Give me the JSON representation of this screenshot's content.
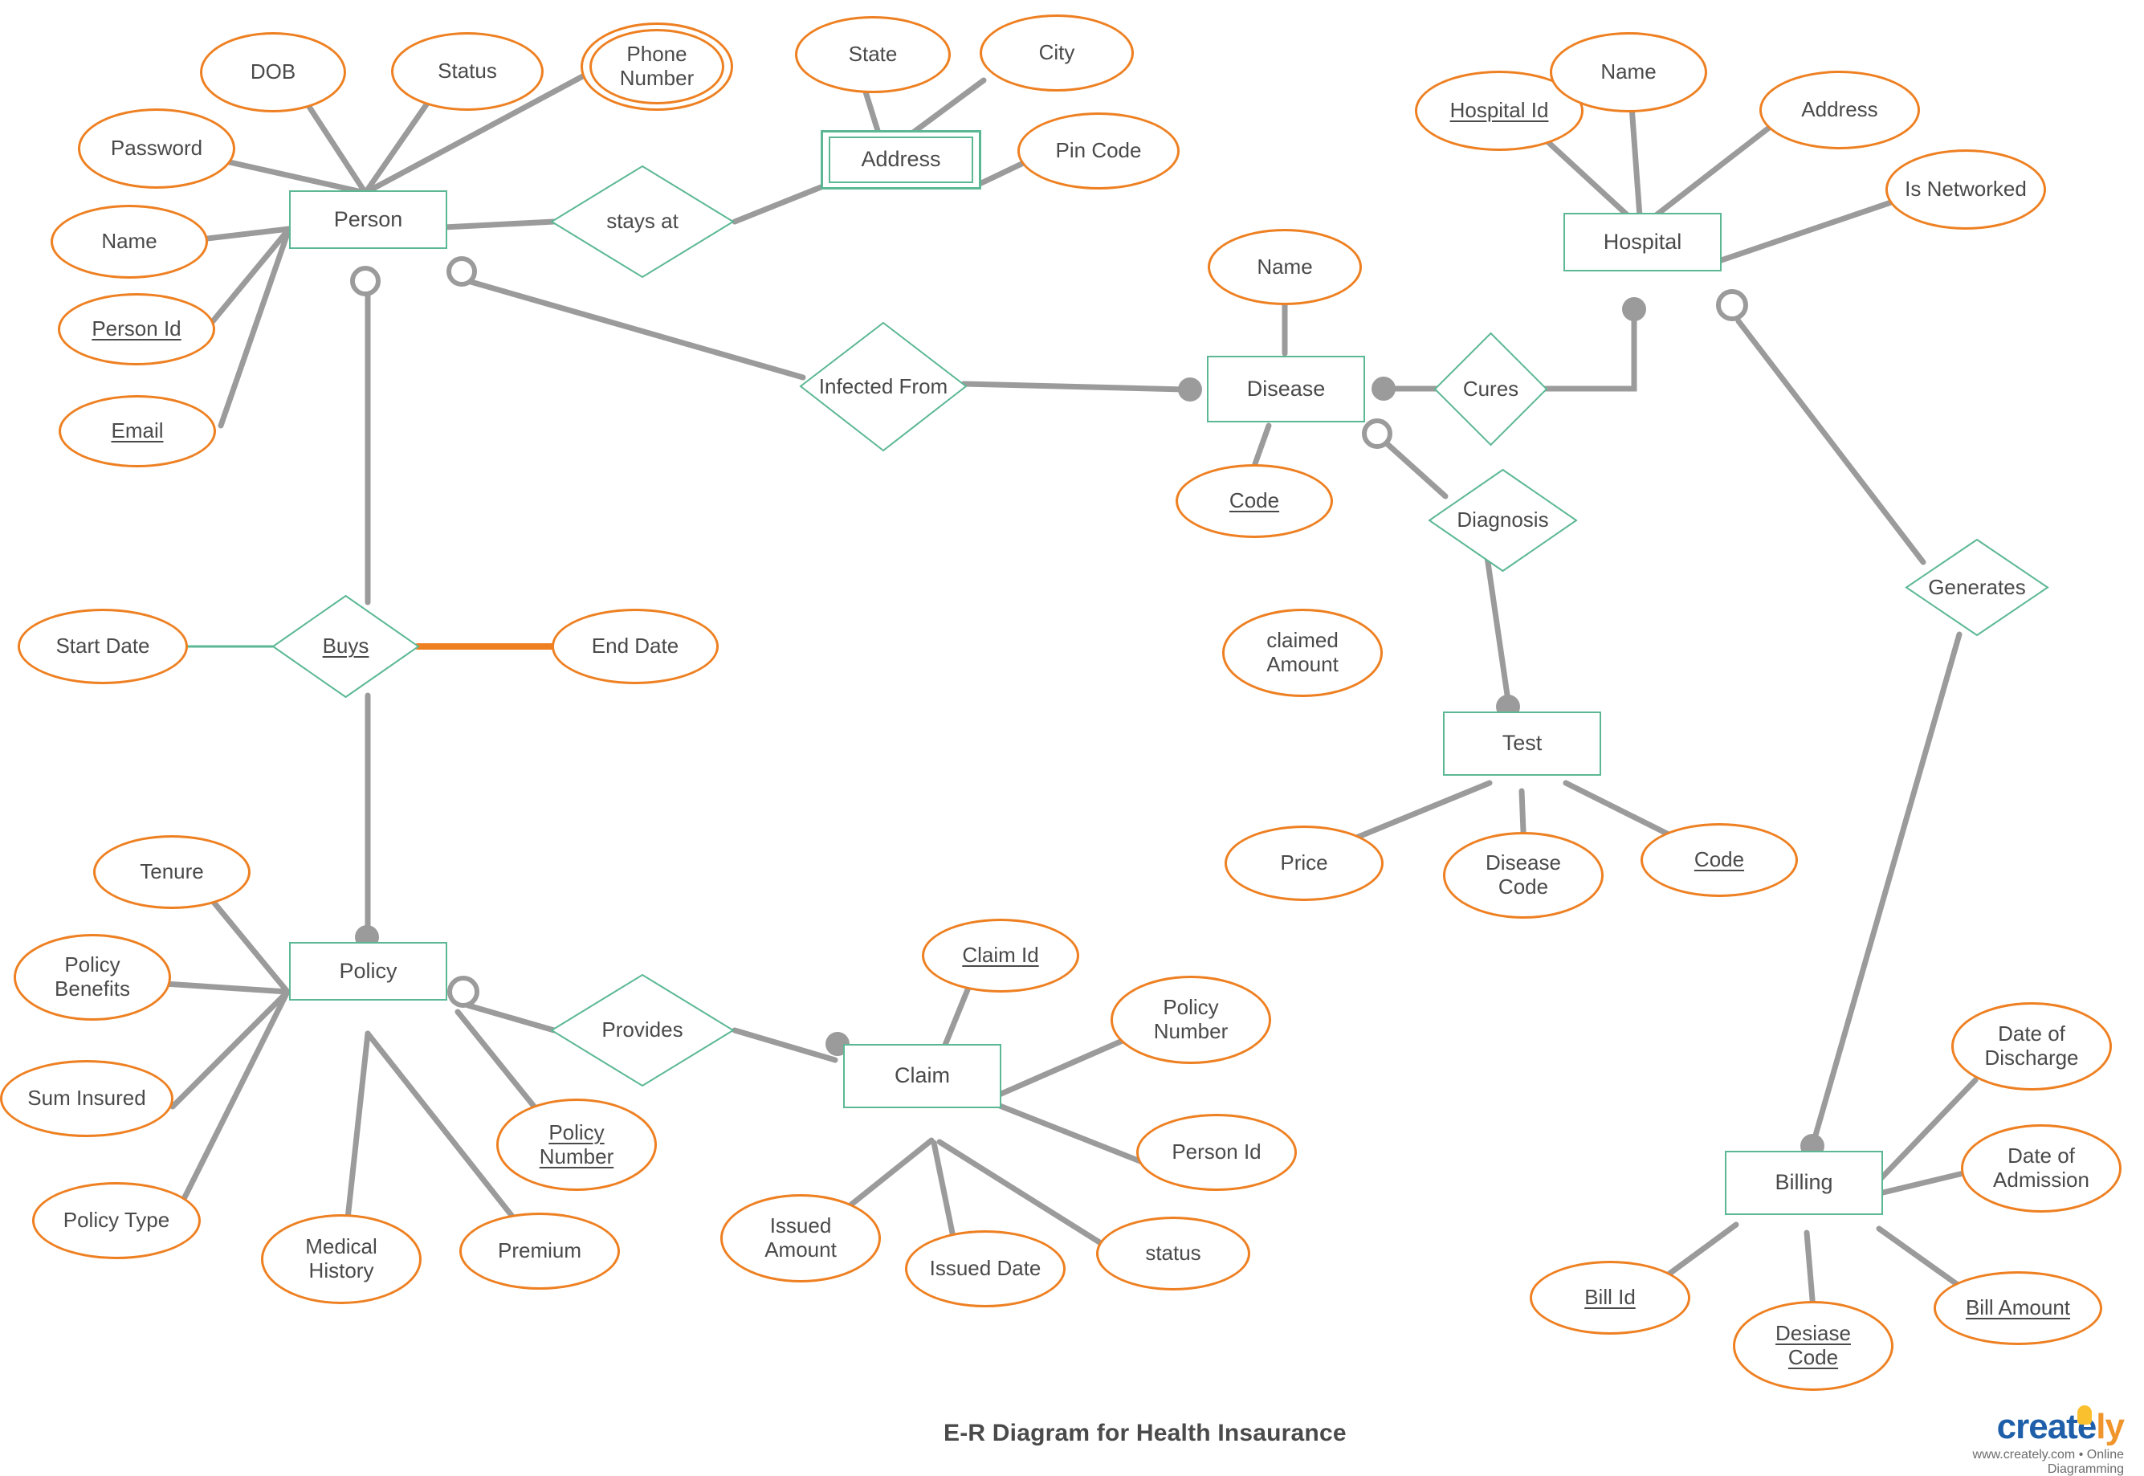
{
  "diagram": {
    "title": "E-R Diagram for Health Insaurance",
    "colors": {
      "entity_stroke": "#5cb894",
      "attribute_stroke": "#ee8022",
      "relationship_stroke": "#5cb894",
      "connector": "#9b9b9b",
      "text": "#4a4a4a",
      "start_date_link": "#5cb894",
      "end_date_link": "#ee8022"
    },
    "entities": [
      {
        "id": "person",
        "label": "Person",
        "type": "entity"
      },
      {
        "id": "address",
        "label": "Address",
        "type": "weak-entity"
      },
      {
        "id": "hospital",
        "label": "Hospital",
        "type": "entity"
      },
      {
        "id": "disease",
        "label": "Disease",
        "type": "entity"
      },
      {
        "id": "test",
        "label": "Test",
        "type": "entity"
      },
      {
        "id": "policy",
        "label": "Policy",
        "type": "entity"
      },
      {
        "id": "claim",
        "label": "Claim",
        "type": "entity"
      },
      {
        "id": "billing",
        "label": "Billing",
        "type": "entity"
      }
    ],
    "relationships": [
      {
        "id": "stays-at",
        "label": "stays at",
        "key": false
      },
      {
        "id": "infected-from",
        "label": "Infected From",
        "key": false
      },
      {
        "id": "cures",
        "label": "Cures",
        "key": false
      },
      {
        "id": "diagnosis",
        "label": "Diagnosis",
        "key": false
      },
      {
        "id": "generates",
        "label": "Generates",
        "key": false
      },
      {
        "id": "buys",
        "label": "Buys",
        "key": true
      },
      {
        "id": "provides",
        "label": "Provides",
        "key": false
      }
    ],
    "attributes": {
      "person": [
        {
          "id": "dob",
          "label": "DOB",
          "key": false,
          "multivalued": false
        },
        {
          "id": "status",
          "label": "Status",
          "key": false,
          "multivalued": false
        },
        {
          "id": "phone-number",
          "label": "Phone Number",
          "key": false,
          "multivalued": true
        },
        {
          "id": "password",
          "label": "Password",
          "key": false,
          "multivalued": false
        },
        {
          "id": "name",
          "label": "Name",
          "key": false,
          "multivalued": false
        },
        {
          "id": "person-id",
          "label": "Person Id",
          "key": true,
          "multivalued": false
        },
        {
          "id": "email",
          "label": "Email",
          "key": true,
          "multivalued": false
        }
      ],
      "address": [
        {
          "id": "state",
          "label": "State",
          "key": false,
          "multivalued": false
        },
        {
          "id": "city",
          "label": "City",
          "key": false,
          "multivalued": false
        },
        {
          "id": "pin-code",
          "label": "Pin Code",
          "key": false,
          "multivalued": false
        }
      ],
      "hospital": [
        {
          "id": "hospital-id",
          "label": "Hospital Id",
          "key": true,
          "multivalued": false
        },
        {
          "id": "hosp-name",
          "label": "Name",
          "key": false,
          "multivalued": false
        },
        {
          "id": "hosp-address",
          "label": "Address",
          "key": false,
          "multivalued": false
        },
        {
          "id": "is-networked",
          "label": "Is Networked",
          "key": false,
          "multivalued": false
        }
      ],
      "disease": [
        {
          "id": "disease-name",
          "label": "Name",
          "key": false,
          "multivalued": false
        },
        {
          "id": "disease-code",
          "label": "Code",
          "key": true,
          "multivalued": false
        }
      ],
      "test": [
        {
          "id": "price",
          "label": "Price",
          "key": false,
          "multivalued": false
        },
        {
          "id": "test-diseasecode",
          "label": "Disease Code",
          "key": false,
          "multivalued": false
        },
        {
          "id": "test-code",
          "label": "Code",
          "key": true,
          "multivalued": false
        }
      ],
      "policy": [
        {
          "id": "tenure",
          "label": "Tenure",
          "key": false,
          "multivalued": false
        },
        {
          "id": "policy-benefits",
          "label": "Policy Benefits",
          "key": false,
          "multivalued": false
        },
        {
          "id": "sum-insured",
          "label": "Sum Insured",
          "key": false,
          "multivalued": false
        },
        {
          "id": "policy-type",
          "label": "Policy Type",
          "key": false,
          "multivalued": false
        },
        {
          "id": "medical-history",
          "label": "Medical History",
          "key": false,
          "multivalued": false
        },
        {
          "id": "premium",
          "label": "Premium",
          "key": false,
          "multivalued": false
        },
        {
          "id": "policy-number",
          "label": "Policy Number",
          "key": true,
          "multivalued": false
        }
      ],
      "claim": [
        {
          "id": "claim-id",
          "label": "Claim Id",
          "key": true,
          "multivalued": false
        },
        {
          "id": "claim-policynumber",
          "label": "Policy Number",
          "key": false,
          "multivalued": false
        },
        {
          "id": "claim-personid",
          "label": "Person Id",
          "key": false,
          "multivalued": false
        },
        {
          "id": "issued-amount",
          "label": "Issued Amount",
          "key": false,
          "multivalued": false
        },
        {
          "id": "issued-date",
          "label": "Issued Date",
          "key": false,
          "multivalued": false
        },
        {
          "id": "claim-status",
          "label": "status",
          "key": false,
          "multivalued": false
        }
      ],
      "billing": [
        {
          "id": "date-of-discharge",
          "label": "Date of Discharge",
          "key": false,
          "multivalued": false
        },
        {
          "id": "date-of-admission",
          "label": "Date of Admission",
          "key": false,
          "multivalued": false
        },
        {
          "id": "bill-id",
          "label": "Bill Id",
          "key": true,
          "multivalued": false
        },
        {
          "id": "desiase-code",
          "label": "Desiase Code",
          "key": true,
          "multivalued": false
        },
        {
          "id": "bill-amount",
          "label": "Bill Amount",
          "key": true,
          "multivalued": false
        }
      ],
      "buys": [
        {
          "id": "start-date",
          "label": "Start Date",
          "key": false,
          "multivalued": false
        },
        {
          "id": "end-date",
          "label": "End Date",
          "key": false,
          "multivalued": false
        }
      ],
      "unattached": [
        {
          "id": "claimed-amount",
          "label": "claimed Amount",
          "key": false,
          "multivalued": false
        }
      ]
    },
    "footer": {
      "logo_create": "create",
      "logo_ly": "ly",
      "logo_sub": "www.creately.com • Online Diagramming"
    }
  }
}
